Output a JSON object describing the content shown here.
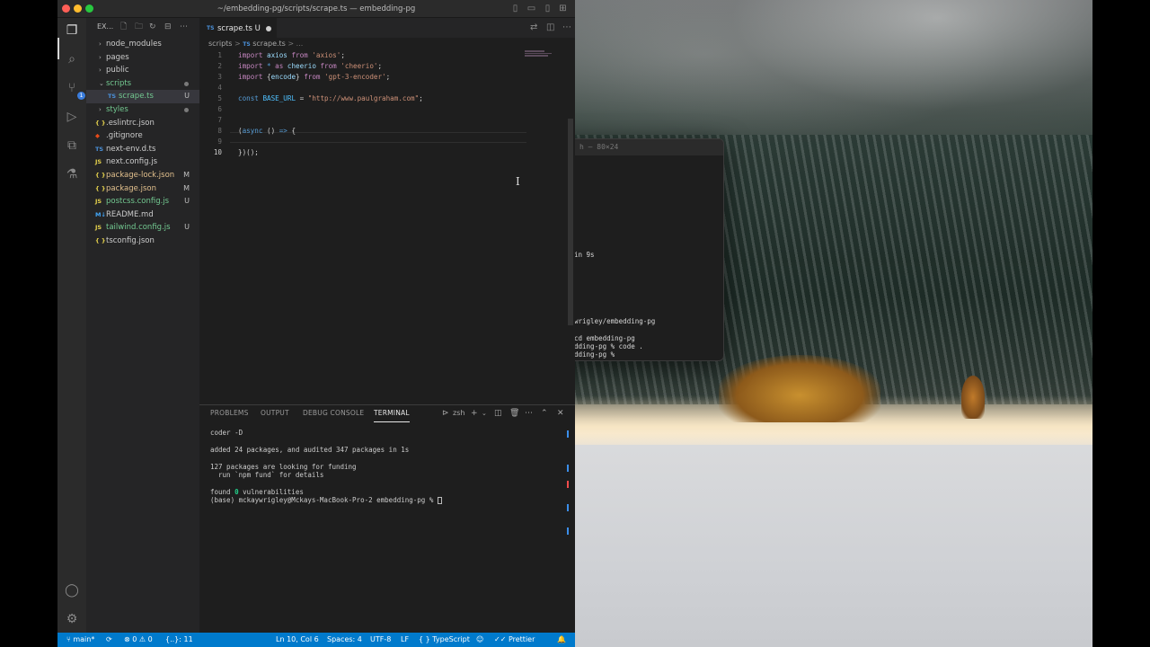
{
  "window": {
    "title": "~/embedding-pg/scripts/scrape.ts — embedding-pg"
  },
  "activity": {
    "scm_badge": "1"
  },
  "explorer": {
    "title": "EX...",
    "items": [
      {
        "name": "node_modules",
        "type": "folder",
        "status": ""
      },
      {
        "name": "pages",
        "type": "folder",
        "status": ""
      },
      {
        "name": "public",
        "type": "folder",
        "status": ""
      },
      {
        "name": "scripts",
        "type": "folder-open",
        "status": ""
      },
      {
        "name": "scrape.ts",
        "type": "ts",
        "status": "U"
      },
      {
        "name": "styles",
        "type": "folder",
        "status": ""
      },
      {
        "name": ".eslintrc.json",
        "type": "json",
        "status": ""
      },
      {
        "name": ".gitignore",
        "type": "git",
        "status": ""
      },
      {
        "name": "next-env.d.ts",
        "type": "ts",
        "status": ""
      },
      {
        "name": "next.config.js",
        "type": "js",
        "status": ""
      },
      {
        "name": "package-lock.json",
        "type": "json",
        "status": "M"
      },
      {
        "name": "package.json",
        "type": "json",
        "status": "M"
      },
      {
        "name": "postcss.config.js",
        "type": "js",
        "status": "U"
      },
      {
        "name": "README.md",
        "type": "md",
        "status": ""
      },
      {
        "name": "tailwind.config.js",
        "type": "js",
        "status": "U"
      },
      {
        "name": "tsconfig.json",
        "type": "json",
        "status": ""
      }
    ]
  },
  "editor": {
    "tab": {
      "label": "scrape.ts",
      "status": "U",
      "lang": "TS"
    },
    "breadcrumb": {
      "folder": "scripts",
      "sep": ">",
      "file": "scrape.ts",
      "more": "> ..."
    },
    "lines": [
      {
        "n": "1",
        "parts": [
          [
            "kw",
            "import "
          ],
          [
            "id",
            "axios "
          ],
          [
            "kw",
            "from "
          ],
          [
            "str",
            "'axios'"
          ],
          [
            "pun",
            ";"
          ]
        ]
      },
      {
        "n": "2",
        "parts": [
          [
            "kw",
            "import "
          ],
          [
            "blue",
            "* "
          ],
          [
            "kw",
            "as "
          ],
          [
            "id",
            "cheerio "
          ],
          [
            "kw",
            "from "
          ],
          [
            "str",
            "'cheerio'"
          ],
          [
            "pun",
            ";"
          ]
        ]
      },
      {
        "n": "3",
        "parts": [
          [
            "kw",
            "import "
          ],
          [
            "pun",
            "{"
          ],
          [
            "id",
            "encode"
          ],
          [
            "pun",
            "} "
          ],
          [
            "kw",
            "from "
          ],
          [
            "str",
            "'gpt-3-encoder'"
          ],
          [
            "pun",
            ";"
          ]
        ]
      },
      {
        "n": "4",
        "parts": []
      },
      {
        "n": "5",
        "parts": [
          [
            "blue",
            "const "
          ],
          [
            "cn",
            "BASE_URL "
          ],
          [
            "pun",
            "= "
          ],
          [
            "str",
            "\"http://www.paulgraham.com\""
          ],
          [
            "pun",
            ";"
          ]
        ]
      },
      {
        "n": "6",
        "parts": []
      },
      {
        "n": "7",
        "parts": []
      },
      {
        "n": "8",
        "parts": [
          [
            "pun",
            "("
          ],
          [
            "blue",
            "async "
          ],
          [
            "pun",
            "() "
          ],
          [
            "blue",
            "=> "
          ],
          [
            "pun",
            "{"
          ]
        ]
      },
      {
        "n": "9",
        "parts": []
      },
      {
        "n": "10",
        "parts": [
          [
            "pun",
            "})();"
          ]
        ]
      }
    ]
  },
  "panel": {
    "tabs": [
      "PROBLEMS",
      "OUTPUT",
      "DEBUG CONSOLE",
      "TERMINAL"
    ],
    "shell": "zsh",
    "output": [
      "coder -D",
      "",
      "added 24 packages, and audited 347 packages in 1s",
      "",
      "127 packages are looking for funding",
      "  run `npm fund` for details",
      "",
      "found 0 vulnerabilities",
      "(base) mckaywrigley@Mckays-MacBook-Pro-2 embedding-pg % "
    ]
  },
  "statusbar": {
    "branch": "main*",
    "errors": "0",
    "warnings": "0",
    "lang_status": "{..}: 11",
    "position": "Ln 10, Col 6",
    "spaces": "Spaces: 4",
    "encoding": "UTF-8",
    "eol": "LF",
    "language": "TypeScript",
    "formatter": "Prettier"
  },
  "background_terminal": {
    "title": "h — 80×24",
    "lines": [
      "in 9s",
      "wrigley/embedding-pg",
      "cd embedding-pg",
      "dding-pg % code .",
      "dding-pg % "
    ]
  },
  "colors": {
    "statusbar": "#007acc",
    "editor_bg": "#1e1e1e",
    "sidebar_bg": "#252526"
  }
}
